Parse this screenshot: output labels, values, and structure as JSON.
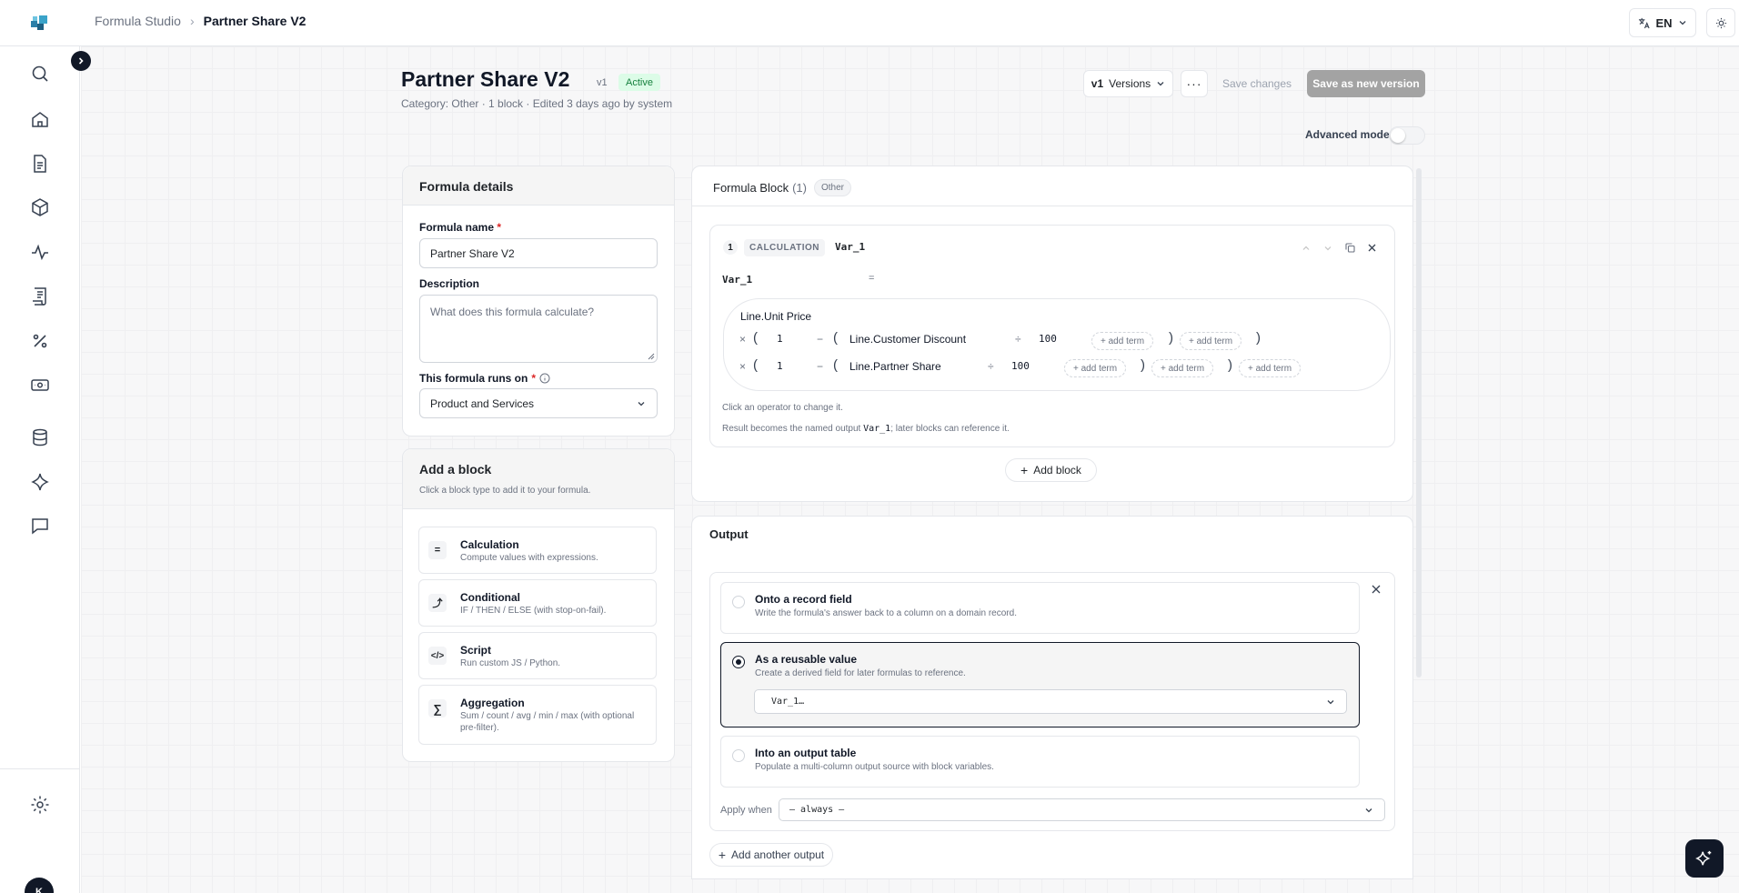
{
  "breadcrumb": {
    "root": "Formula Studio",
    "current": "Partner Share V2"
  },
  "header": {
    "lang": "EN"
  },
  "sidebar": {
    "avatar_initial": "K"
  },
  "page": {
    "title": "Partner Share V2",
    "version_tag": "v1",
    "status": "Active",
    "subtitle": "Category: Other · 1 block · Edited 3 days ago by system",
    "versions_prefix": "v1",
    "versions_label": "Versions",
    "save_label": "Save changes",
    "save_new_label": "Save as new version",
    "advanced_mode": "Advanced mode"
  },
  "details": {
    "title": "Formula details",
    "name_label": "Formula name",
    "name_value": "Partner Share V2",
    "desc_label": "Description",
    "desc_placeholder": "What does this formula calculate?",
    "runs_on_label": "This formula runs on",
    "runs_on_value": "Product and Services"
  },
  "add_block": {
    "title": "Add a block",
    "subtitle": "Click a block type to add it to your formula.",
    "items": [
      {
        "icon": "=",
        "title": "Calculation",
        "desc": "Compute values with expressions."
      },
      {
        "icon": "⤴",
        "title": "Conditional",
        "desc": "IF / THEN / ELSE (with stop-on-fail)."
      },
      {
        "icon": "</>",
        "title": "Script",
        "desc": "Run custom JS / Python."
      },
      {
        "icon": "∑",
        "title": "Aggregation",
        "desc": "Sum / count / avg / min / max (with optional pre-filter)."
      }
    ]
  },
  "formula_block": {
    "title": "Formula Block",
    "count": "(1)",
    "category": "Other",
    "block": {
      "index": "1",
      "type": "CALCULATION",
      "var_name": "Var_1",
      "lhs": "Var_1",
      "equals": "=",
      "base": "Line.Unit Price",
      "row1": {
        "times": "×",
        "open": "(",
        "one": "1",
        "minus": "−",
        "open2": "(",
        "field": "Line.Customer Discount",
        "div": "÷",
        "hundred": "100",
        "add1": "+ add term",
        "close": ")",
        "add2": "+ add term",
        "close2": ")"
      },
      "row2": {
        "times": "×",
        "open": "(",
        "one": "1",
        "minus": "−",
        "open2": "(",
        "field": "Line.Partner Share",
        "div": "÷",
        "hundred": "100",
        "add1": "+ add term",
        "close": ")",
        "add2": "+ add term",
        "close2": ")",
        "add3": "+ add term"
      },
      "hint1": "Click an operator to change it.",
      "hint2_a": "Result becomes the named output ",
      "hint2_var": "Var_1",
      "hint2_b": "; later blocks can reference it."
    },
    "add_block_label": "Add block"
  },
  "output": {
    "title": "Output",
    "options": [
      {
        "title": "Onto a record field",
        "desc": "Write the formula's answer back to a column on a domain record.",
        "selected": false
      },
      {
        "title": "As a reusable value",
        "desc": "Create a derived field for later formulas to reference.",
        "selected": true,
        "field_value": "Var_1…"
      },
      {
        "title": "Into an output table",
        "desc": "Populate a multi-column output source with block variables.",
        "selected": false
      }
    ],
    "apply_when_label": "Apply when",
    "apply_when_value": "— always —",
    "add_output_label": "Add another output"
  }
}
